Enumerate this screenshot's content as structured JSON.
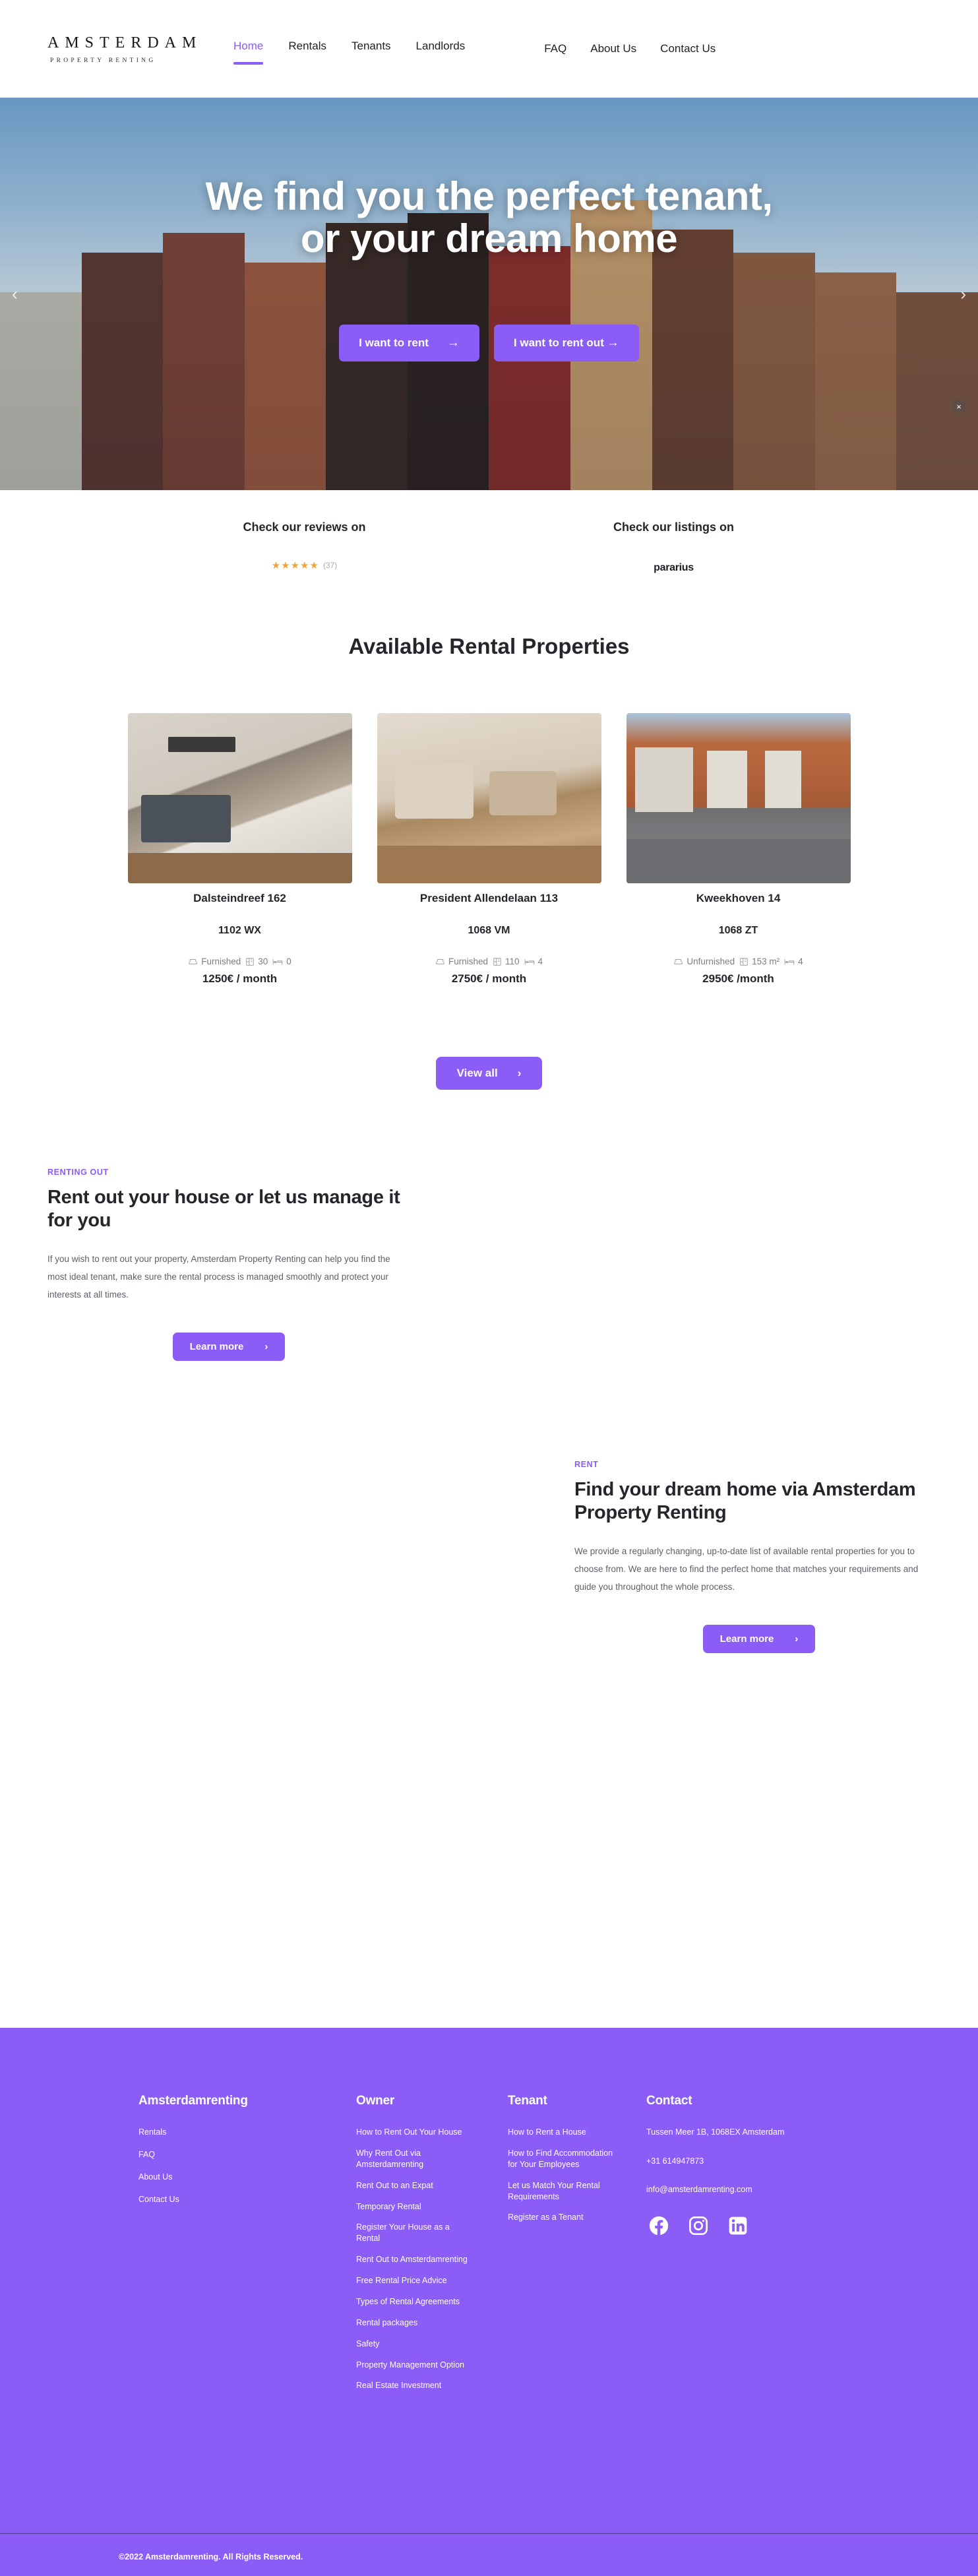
{
  "brand": {
    "logo_main": "AMSTERDAM",
    "logo_sub": "PROPERTY RENTING"
  },
  "nav": {
    "primary": [
      {
        "label": "Home",
        "active": true
      },
      {
        "label": "Rentals",
        "active": false
      },
      {
        "label": "Tenants",
        "active": false
      },
      {
        "label": "Landlords",
        "active": false
      }
    ],
    "secondary": [
      {
        "label": "FAQ"
      },
      {
        "label": "About Us"
      },
      {
        "label": "Contact Us"
      }
    ]
  },
  "hero": {
    "title_line1": "We find you the perfect tenant,",
    "title_line2": "or your dream home",
    "btn_rent": "I want to rent",
    "btn_rent_out": "I want to rent out",
    "arrow_right": "→",
    "prev_icon": "‹",
    "next_icon": "›",
    "close_icon": "×"
  },
  "reviews": {
    "left_heading": "Check our reviews on",
    "stars": "★★★★★",
    "review_count": "(37)",
    "right_heading": "Check our listings on",
    "listing_partner": "pararius"
  },
  "listings": {
    "title": "Available Rental Properties",
    "view_all_label": "View all",
    "view_all_arrow": "›",
    "cards": [
      {
        "name": "Dalsteindreef 162",
        "zip": "1102 WX",
        "furnishing": "Furnished",
        "area": "30",
        "bedrooms": "0",
        "price": "1250€ / month"
      },
      {
        "name": "President Allendelaan 113",
        "zip": "1068 VM",
        "furnishing": "Furnished",
        "area": "110",
        "bedrooms": "4",
        "price": "2750€ / month"
      },
      {
        "name": "Kweekhoven 14",
        "zip": "1068 ZT",
        "furnishing": "Unfurnished",
        "area": "153 m²",
        "bedrooms": "4",
        "price": "2950€ /month"
      }
    ]
  },
  "feature_rentout": {
    "eyebrow": "RENTING OUT",
    "heading": "Rent out your house or let us manage it for you",
    "body": "If you wish to rent out your property, Amsterdam Property Renting can help you find the most ideal tenant, make sure the rental process is managed smoothly and protect your interests at all times.",
    "button": "Learn more",
    "button_arrow": "›"
  },
  "feature_rent": {
    "eyebrow": "RENT",
    "heading": "Find your dream home via Amsterdam Property Renting",
    "body": "We provide a regularly changing, up-to-date list of available rental properties for you to choose from. We are here to find the perfect home that matches your requirements and guide you throughout the whole process.",
    "button": "Learn more",
    "button_arrow": "›"
  },
  "footer": {
    "col1": {
      "heading": "Amsterdamrenting",
      "links": [
        "Rentals",
        "FAQ",
        "About Us",
        "Contact Us"
      ]
    },
    "col2": {
      "heading": "Owner",
      "links": [
        "How to Rent Out Your House",
        "Why Rent Out via Amsterdamrenting",
        "Rent Out to an Expat",
        "Temporary Rental",
        "Register Your House as a Rental",
        "Rent Out to Amsterdamrenting",
        "Free Rental Price Advice",
        "Types of Rental Agreements",
        "Rental packages",
        "Safety",
        "Property Management Option",
        "Real Estate Investment"
      ]
    },
    "col3": {
      "heading": "Tenant",
      "links": [
        "How to Rent a House",
        "How to Find Accommodation for Your Employees",
        "Let us Match Your Rental Requirements",
        "Register as a Tenant"
      ]
    },
    "col4": {
      "heading": "Contact",
      "address": "Tussen Meer 1B, 1068EX Amsterdam",
      "phone": "+31 614947873",
      "email": "info@amsterdamrenting.com",
      "socials": [
        "facebook-icon",
        "instagram-icon",
        "linkedin-icon"
      ]
    },
    "copyright": "©2022 Amsterdamrenting. All Rights Reserved."
  },
  "colors": {
    "accent": "#8b5cf6",
    "text": "#24262b",
    "muted": "#5e6069",
    "star": "#f0a43a"
  }
}
